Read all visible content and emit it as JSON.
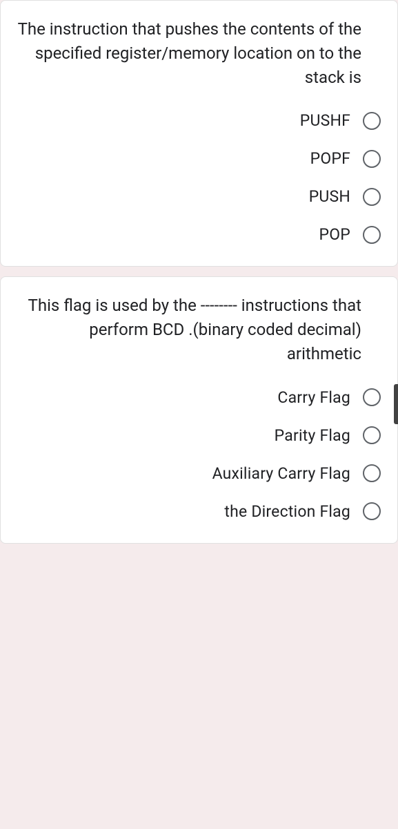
{
  "questions": [
    {
      "text": "The instruction that pushes the contents of the specified register/memory location on to the stack is",
      "options": [
        {
          "label": "PUSHF"
        },
        {
          "label": "POPF"
        },
        {
          "label": "PUSH"
        },
        {
          "label": "POP"
        }
      ]
    },
    {
      "text": "This flag is used by the -------- instructions that perform BCD .(binary coded decimal) arithmetic",
      "options": [
        {
          "label": "Carry Flag"
        },
        {
          "label": "Parity Flag"
        },
        {
          "label": "Auxiliary Carry Flag"
        },
        {
          "label": "the Direction Flag"
        }
      ]
    }
  ]
}
